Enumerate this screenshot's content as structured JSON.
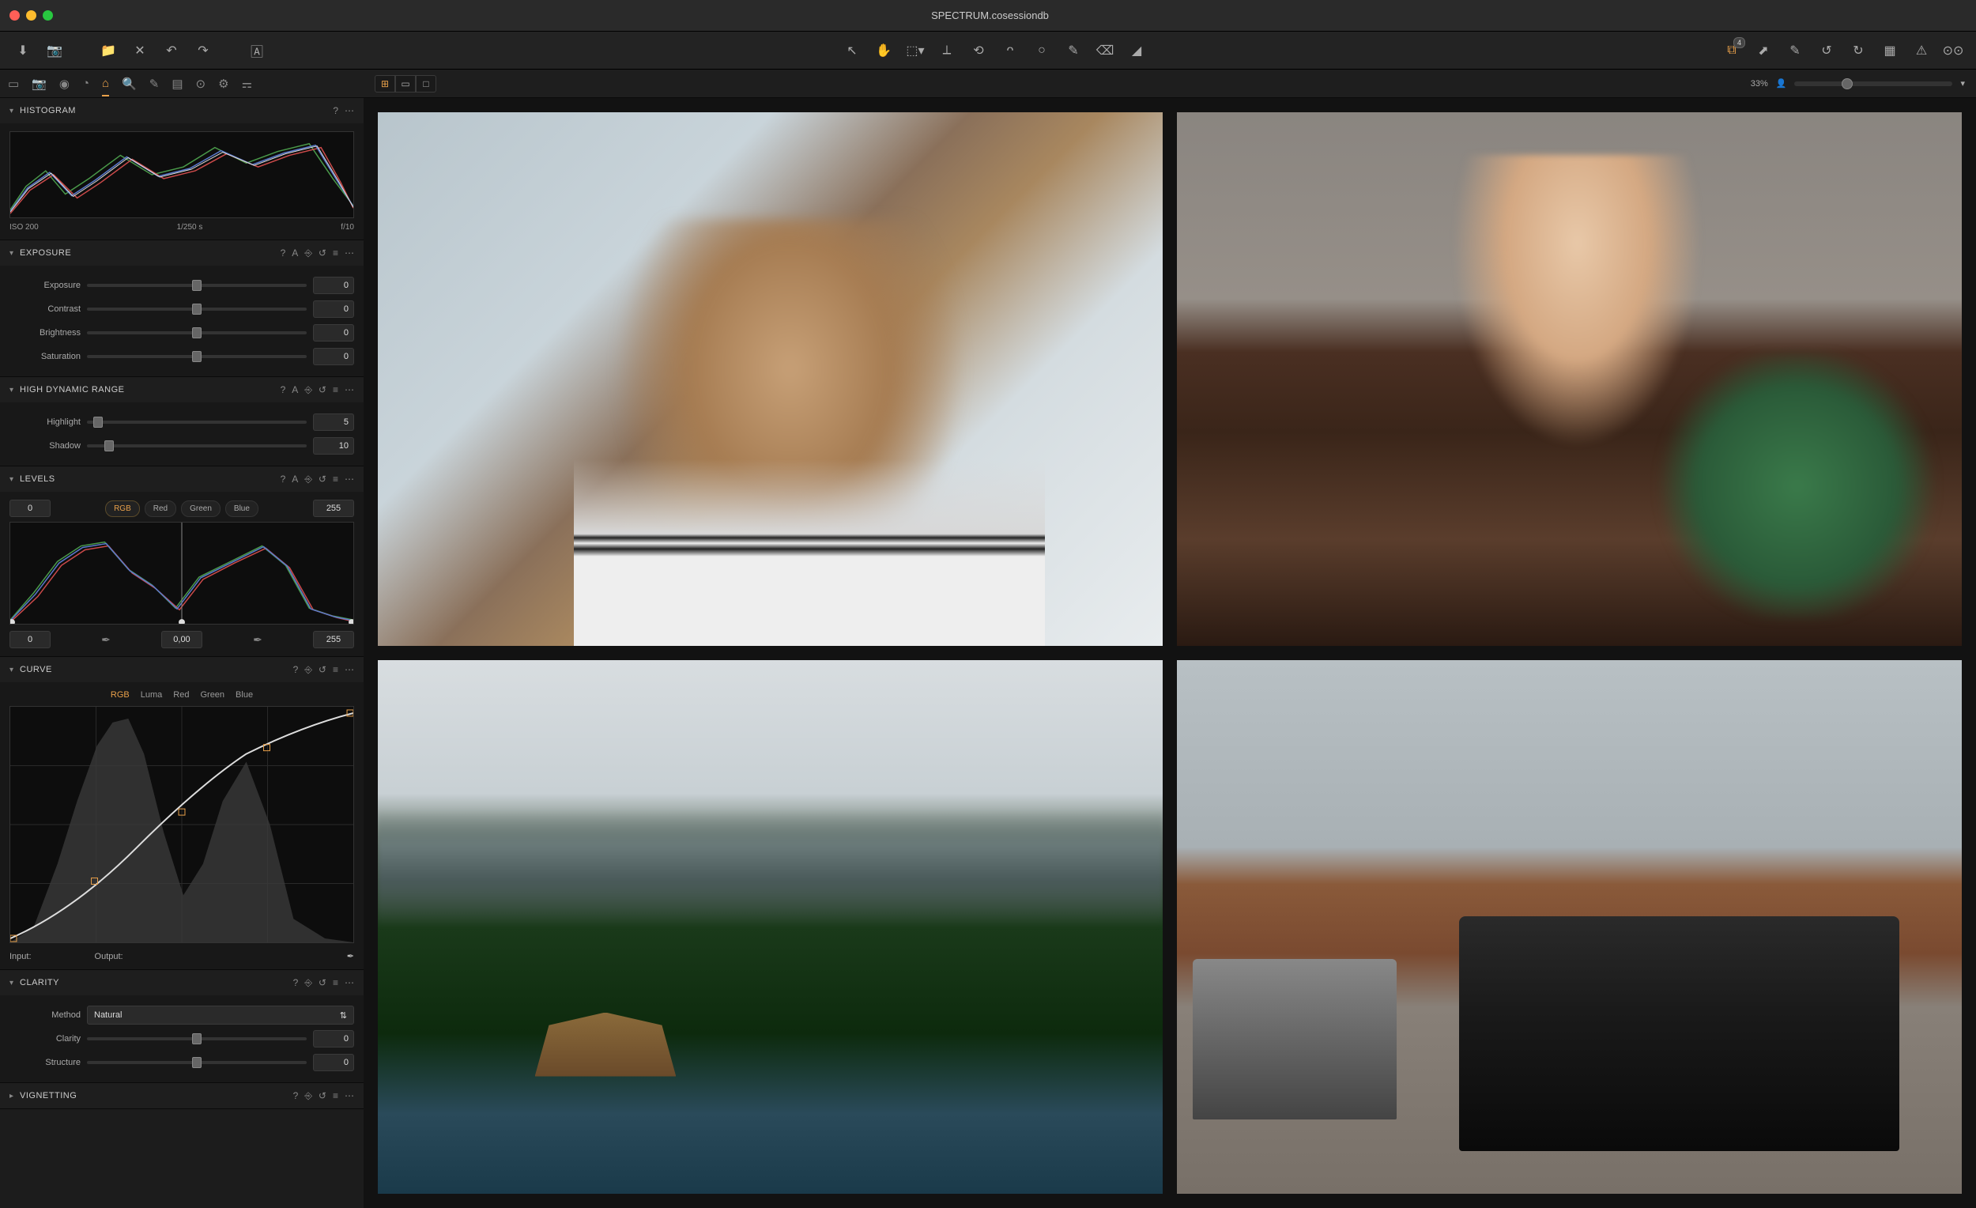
{
  "window": {
    "title": "SPECTRUM.cosessiondb"
  },
  "toolbar": {
    "batch_badge": "4"
  },
  "viewer": {
    "zoom": "33%"
  },
  "panels": {
    "histogram": {
      "title": "HISTOGRAM",
      "iso": "ISO 200",
      "shutter": "1/250 s",
      "aperture": "f/10"
    },
    "exposure": {
      "title": "EXPOSURE",
      "exposure_label": "Exposure",
      "exposure_value": "0",
      "contrast_label": "Contrast",
      "contrast_value": "0",
      "brightness_label": "Brightness",
      "brightness_value": "0",
      "saturation_label": "Saturation",
      "saturation_value": "0"
    },
    "hdr": {
      "title": "HIGH DYNAMIC RANGE",
      "highlight_label": "Highlight",
      "highlight_value": "5",
      "shadow_label": "Shadow",
      "shadow_value": "10"
    },
    "levels": {
      "title": "LEVELS",
      "in_black": "0",
      "in_white": "255",
      "out_black": "0",
      "out_mid": "0,00",
      "out_white": "255",
      "rgb": "RGB",
      "red": "Red",
      "green": "Green",
      "blue": "Blue"
    },
    "curve": {
      "title": "CURVE",
      "rgb": "RGB",
      "luma": "Luma",
      "red": "Red",
      "green": "Green",
      "blue": "Blue",
      "input_label": "Input:",
      "output_label": "Output:"
    },
    "clarity": {
      "title": "CLARITY",
      "method_label": "Method",
      "method_value": "Natural",
      "clarity_label": "Clarity",
      "clarity_value": "0",
      "structure_label": "Structure",
      "structure_value": "0"
    },
    "vignetting": {
      "title": "VIGNETTING"
    }
  }
}
